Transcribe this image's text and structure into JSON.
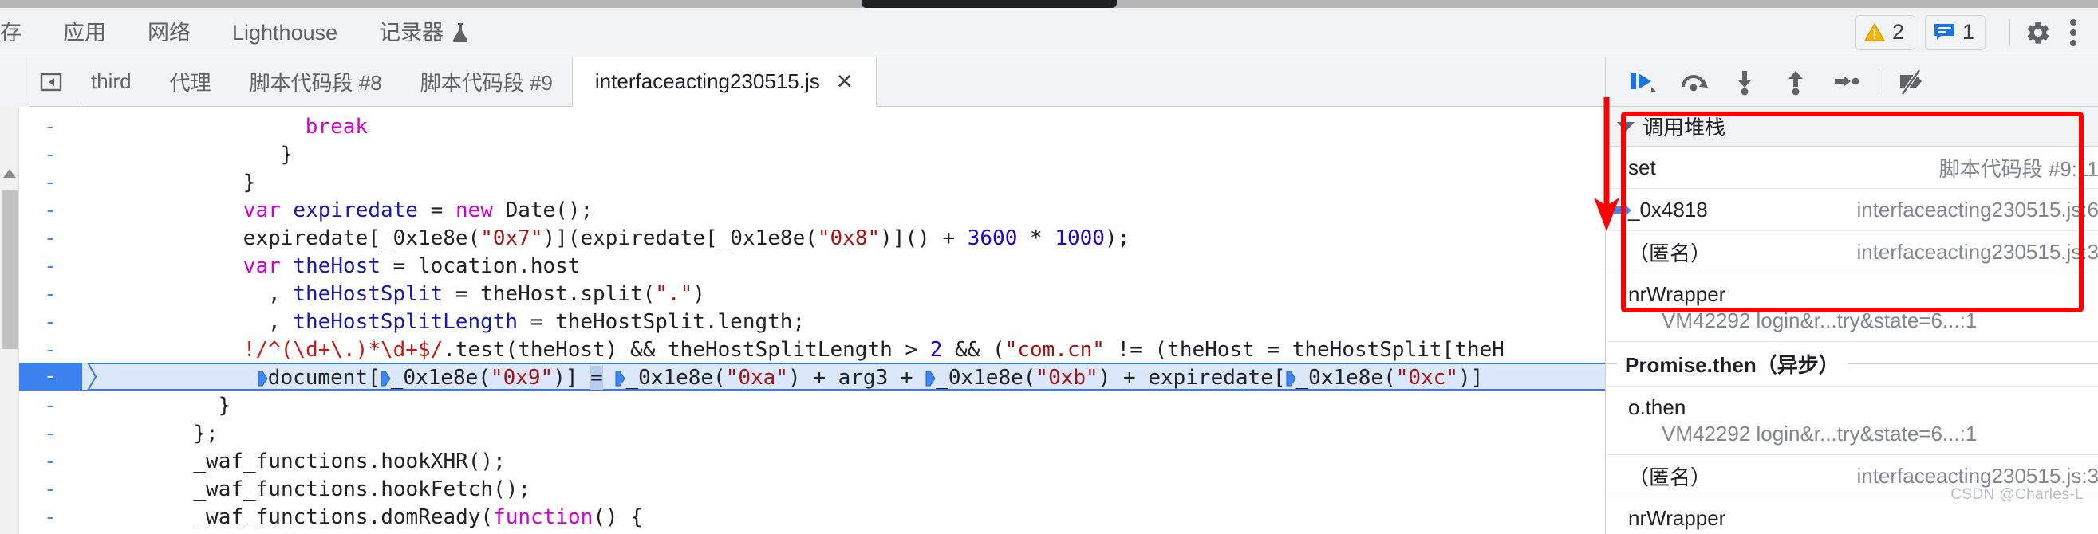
{
  "panel_tabs": [
    {
      "label": "存",
      "icon": null
    },
    {
      "label": "应用",
      "icon": null
    },
    {
      "label": "网络",
      "icon": null
    },
    {
      "label": "Lighthouse",
      "icon": null
    },
    {
      "label": "记录器",
      "icon": "flask-icon"
    }
  ],
  "status": {
    "warning_count": "2",
    "message_count": "1",
    "warning_icon": "warning-triangle-icon",
    "message_icon": "message-box-icon",
    "settings_icon": "gear-icon",
    "more_icon": "kebab-menu-icon"
  },
  "source_tabs": {
    "panel_toggle_icon": "show-navigator-icon",
    "items": [
      {
        "label": "third",
        "active": false
      },
      {
        "label": "代理",
        "active": false
      },
      {
        "label": "脚本代码段 #8",
        "active": false
      },
      {
        "label": "脚本代码段 #9",
        "active": false
      },
      {
        "label": "interfaceacting230515.js",
        "active": true,
        "close": "✕"
      }
    ],
    "more_icon": "show-more-tabs-icon"
  },
  "editor": {
    "fold_mark": "-",
    "highlighted_line_index": 9,
    "lines": [
      {
        "indent": 18,
        "tokens": [
          {
            "t": "break",
            "c": "kw"
          }
        ]
      },
      {
        "indent": 16,
        "tokens": [
          {
            "t": "}",
            "c": "plain"
          }
        ]
      },
      {
        "indent": 13,
        "tokens": [
          {
            "t": "}",
            "c": "plain"
          }
        ]
      },
      {
        "indent": 13,
        "tokens": [
          {
            "t": "var ",
            "c": "kw"
          },
          {
            "t": "expiredate",
            "c": "id"
          },
          {
            "t": " = ",
            "c": "plain"
          },
          {
            "t": "new ",
            "c": "kw"
          },
          {
            "t": "Date();",
            "c": "plain"
          }
        ]
      },
      {
        "indent": 13,
        "tokens": [
          {
            "t": "expiredate[_0x1e8e(",
            "c": "plain"
          },
          {
            "t": "\"0x7\"",
            "c": "str"
          },
          {
            "t": ")](expiredate[_0x1e8e(",
            "c": "plain"
          },
          {
            "t": "\"0x8\"",
            "c": "str"
          },
          {
            "t": ")]() + ",
            "c": "plain"
          },
          {
            "t": "3600",
            "c": "num"
          },
          {
            "t": " * ",
            "c": "plain"
          },
          {
            "t": "1000",
            "c": "num"
          },
          {
            "t": ");",
            "c": "plain"
          }
        ]
      },
      {
        "indent": 13,
        "tokens": [
          {
            "t": "var ",
            "c": "kw"
          },
          {
            "t": "theHost",
            "c": "id"
          },
          {
            "t": " = location.host",
            "c": "plain"
          }
        ]
      },
      {
        "indent": 15,
        "tokens": [
          {
            "t": ", ",
            "c": "plain"
          },
          {
            "t": "theHostSplit",
            "c": "id"
          },
          {
            "t": " = theHost.split(",
            "c": "plain"
          },
          {
            "t": "\".\"",
            "c": "str"
          },
          {
            "t": ")",
            "c": "plain"
          }
        ]
      },
      {
        "indent": 15,
        "tokens": [
          {
            "t": ", ",
            "c": "plain"
          },
          {
            "t": "theHostSplitLength",
            "c": "id"
          },
          {
            "t": " = theHostSplit.length;",
            "c": "plain"
          }
        ]
      },
      {
        "indent": 13,
        "tokens": [
          {
            "t": "!/^(\\d+\\.)*\\d+$/",
            "c": "re"
          },
          {
            "t": ".test(theHost) && theHostSplitLength > ",
            "c": "plain"
          },
          {
            "t": "2",
            "c": "num"
          },
          {
            "t": " && (",
            "c": "plain"
          },
          {
            "t": "\"com.cn\"",
            "c": "str"
          },
          {
            "t": " != (theHost = theHostSplit[theH",
            "c": "plain"
          }
        ]
      },
      {
        "indent": 13,
        "tokens": [
          {
            "t": "TRI",
            "c": "tri"
          },
          {
            "t": "document[",
            "c": "plain"
          },
          {
            "t": "TRI",
            "c": "tri"
          },
          {
            "t": "_0x1e8e(",
            "c": "plain"
          },
          {
            "t": "\"0x9\"",
            "c": "str"
          },
          {
            "t": ")] ",
            "c": "plain"
          },
          {
            "t": "=",
            "c": "selop"
          },
          {
            "t": " ",
            "c": "plain"
          },
          {
            "t": "TRI",
            "c": "tri"
          },
          {
            "t": "_0x1e8e(",
            "c": "plain"
          },
          {
            "t": "\"0xa\"",
            "c": "str"
          },
          {
            "t": ") + arg3 + ",
            "c": "plain"
          },
          {
            "t": "TRI",
            "c": "tri"
          },
          {
            "t": "_0x1e8e(",
            "c": "plain"
          },
          {
            "t": "\"0xb\"",
            "c": "str"
          },
          {
            "t": ") + expiredate[",
            "c": "plain"
          },
          {
            "t": "TRI",
            "c": "tri"
          },
          {
            "t": "_0x1e8e(",
            "c": "plain"
          },
          {
            "t": "\"0xc\"",
            "c": "str"
          },
          {
            "t": ")]",
            "c": "plain"
          }
        ]
      },
      {
        "indent": 11,
        "tokens": [
          {
            "t": "}",
            "c": "plain"
          }
        ]
      },
      {
        "indent": 9,
        "tokens": [
          {
            "t": "};",
            "c": "plain"
          }
        ]
      },
      {
        "indent": 9,
        "tokens": [
          {
            "t": "_waf_functions.hookXHR();",
            "c": "plain"
          }
        ]
      },
      {
        "indent": 9,
        "tokens": [
          {
            "t": "_waf_functions.hookFetch();",
            "c": "plain"
          }
        ]
      },
      {
        "indent": 9,
        "tokens": [
          {
            "t": "_waf_functions.domReady(",
            "c": "plain"
          },
          {
            "t": "function",
            "c": "kw"
          },
          {
            "t": "() {",
            "c": "plain"
          }
        ]
      }
    ]
  },
  "debugger_toolbar": {
    "buttons": [
      {
        "name": "resume-script-execution",
        "icon": "resume-icon"
      },
      {
        "name": "step-over-next-function-call",
        "icon": "step-over-icon"
      },
      {
        "name": "step-into-next-function-call",
        "icon": "step-into-icon"
      },
      {
        "name": "step-out-of-current-function",
        "icon": "step-out-icon"
      },
      {
        "name": "step",
        "icon": "step-icon"
      },
      {
        "name": "deactivate-breakpoints",
        "icon": "deactivate-breakpoints-icon"
      }
    ]
  },
  "call_stack": {
    "title": "调用堆栈",
    "caret_icon": "chevron-down-icon",
    "selected_icon": "selected-frame-arrow-icon",
    "rows": [
      {
        "type": "frame",
        "name": "set",
        "location": "脚本代码段 #9:11",
        "selected": false,
        "two_line": false
      },
      {
        "type": "frame",
        "name": "_0x4818",
        "location": "interfaceacting230515.js:6",
        "selected": true,
        "two_line": false
      },
      {
        "type": "frame",
        "name": "（匿名）",
        "location": "interfaceacting230515.js:3",
        "selected": false,
        "two_line": false
      },
      {
        "type": "frame",
        "name": "nrWrapper",
        "location": "VM42292 login&r...try&state=6...:1",
        "selected": false,
        "two_line": true
      },
      {
        "type": "separator",
        "name": "Promise.then（异步）"
      },
      {
        "type": "frame",
        "name": "o.then",
        "location": "VM42292 login&r...try&state=6...:1",
        "selected": false,
        "two_line": true
      },
      {
        "type": "frame",
        "name": "（匿名）",
        "location": "interfaceacting230515.js:3",
        "selected": false,
        "two_line": false
      },
      {
        "type": "frame",
        "name": "nrWrapper",
        "location": "",
        "selected": false,
        "two_line": false
      }
    ]
  },
  "annotations": {
    "highlight_box_color": "#ff0000",
    "arrow_color": "#ff0000",
    "watermark": "CSDN @Charles-L"
  }
}
